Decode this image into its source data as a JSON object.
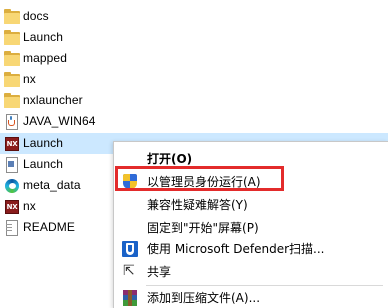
{
  "files": [
    {
      "name": "docs",
      "icon": "folder-icon"
    },
    {
      "name": "Launch",
      "icon": "folder-icon"
    },
    {
      "name": "mapped",
      "icon": "folder-icon"
    },
    {
      "name": "nx",
      "icon": "folder-icon"
    },
    {
      "name": "nxlauncher",
      "icon": "folder-icon"
    },
    {
      "name": "JAVA_WIN64",
      "icon": "java-file-icon"
    },
    {
      "name": "Launch",
      "icon": "nx-app-icon",
      "selected": true
    },
    {
      "name": "Launch",
      "icon": "shortcut-file-icon"
    },
    {
      "name": "meta_data",
      "icon": "edge-html-icon"
    },
    {
      "name": "nx",
      "icon": "nx-app-icon"
    },
    {
      "name": "README",
      "icon": "text-document-icon"
    }
  ],
  "context_menu": {
    "open": "打开(O)",
    "run_as_admin": "以管理员身份运行(A)",
    "troubleshoot_compat": "兼容性疑难解答(Y)",
    "pin_to_start": "固定到\"开始\"屏幕(P)",
    "defender_scan": "使用 Microsoft Defender扫描...",
    "share": "共享",
    "add_to_archive": "添加到压缩文件(A)..."
  },
  "colors": {
    "selection": "#cce8ff",
    "highlight_border": "#e32b2b",
    "folder": "#f8d775"
  }
}
